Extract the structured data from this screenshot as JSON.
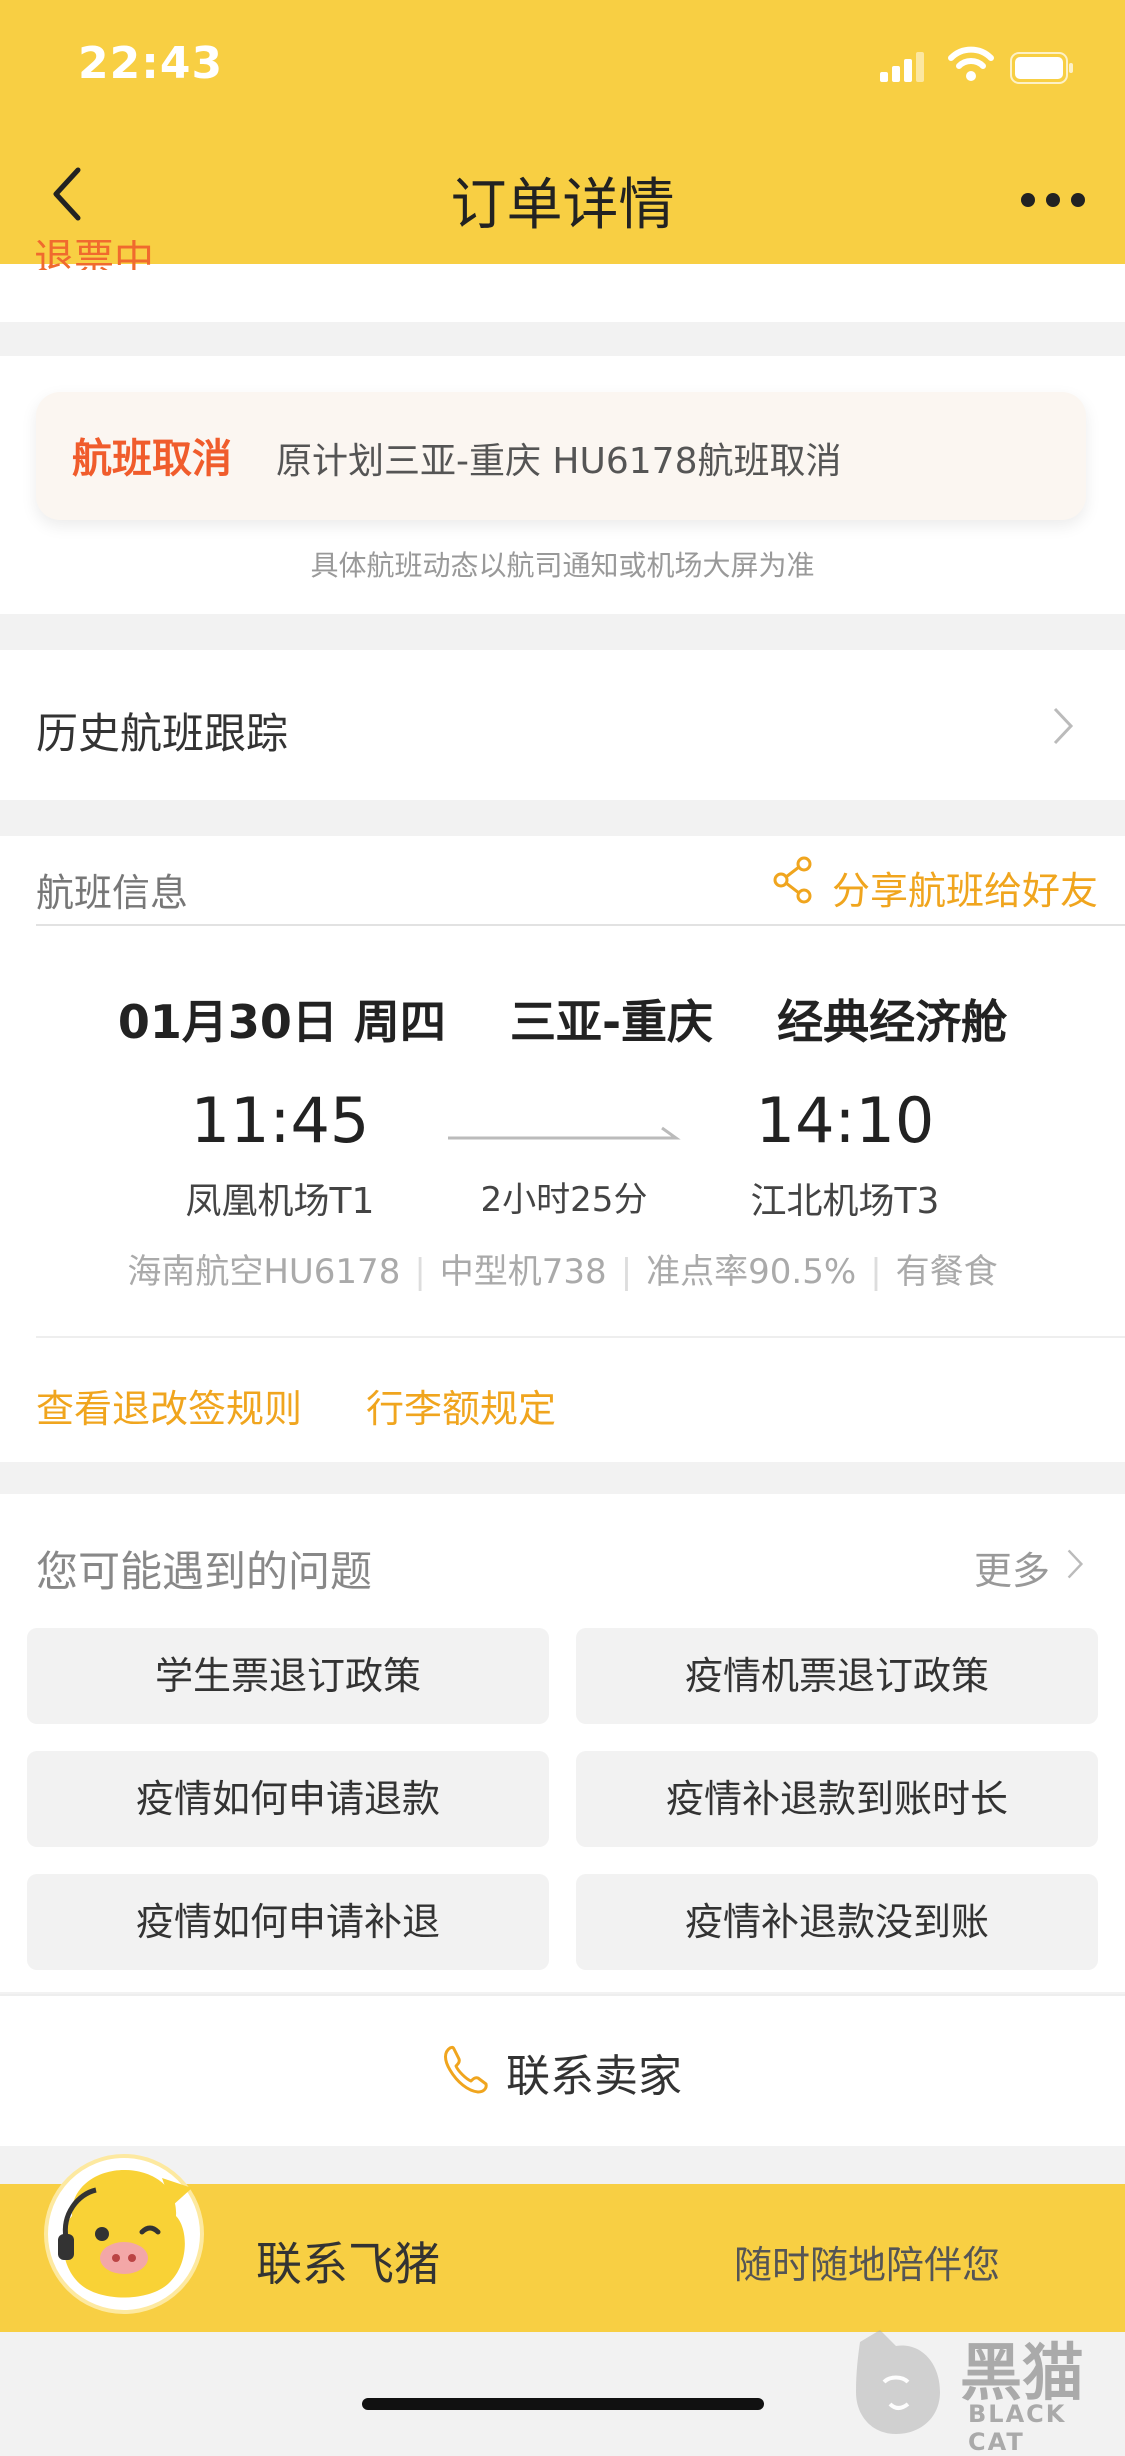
{
  "status_bar": {
    "time": "22:43"
  },
  "nav": {
    "title": "订单详情"
  },
  "peek_text": "退票中",
  "cancel": {
    "tag": "航班取消",
    "text": "原计划三亚-重庆 HU6178航班取消",
    "note": "具体航班动态以航司通知或机场大屏为准"
  },
  "history": {
    "label": "历史航班跟踪"
  },
  "flight_info": {
    "section_title": "航班信息",
    "share": "分享航班给好友",
    "date": "01月30日 周四",
    "route": "三亚-重庆",
    "cabin": "经典经济舱",
    "dep_time": "11:45",
    "arr_time": "14:10",
    "dep_airport": "凤凰机场T1",
    "arr_airport": "江北机场T3",
    "duration": "2小时25分",
    "airline_flight": "海南航空HU6178",
    "aircraft": "中型机738",
    "on_time_rate": "准点率90.5%",
    "meal": "有餐食"
  },
  "links": {
    "refund_rules": "查看退改签规则",
    "baggage": "行李额规定"
  },
  "questions": {
    "title": "您可能遇到的问题",
    "more": "更多",
    "items": [
      "学生票退订政策",
      "疫情机票退订政策",
      "疫情如何申请退款",
      "疫情补退款到账时长",
      "疫情如何申请补退",
      "疫情补退款没到账"
    ]
  },
  "contact_seller": "联系卖家",
  "bottom_bar": {
    "name": "联系飞猪",
    "slogan": "随时随地陪伴您"
  },
  "watermark": {
    "cn": "黑猫",
    "en": "BLACK CAT"
  },
  "colors": {
    "brand_yellow": "#f8cf43",
    "accent_orange": "#f0a51e",
    "cancel_red": "#f05c2c"
  }
}
